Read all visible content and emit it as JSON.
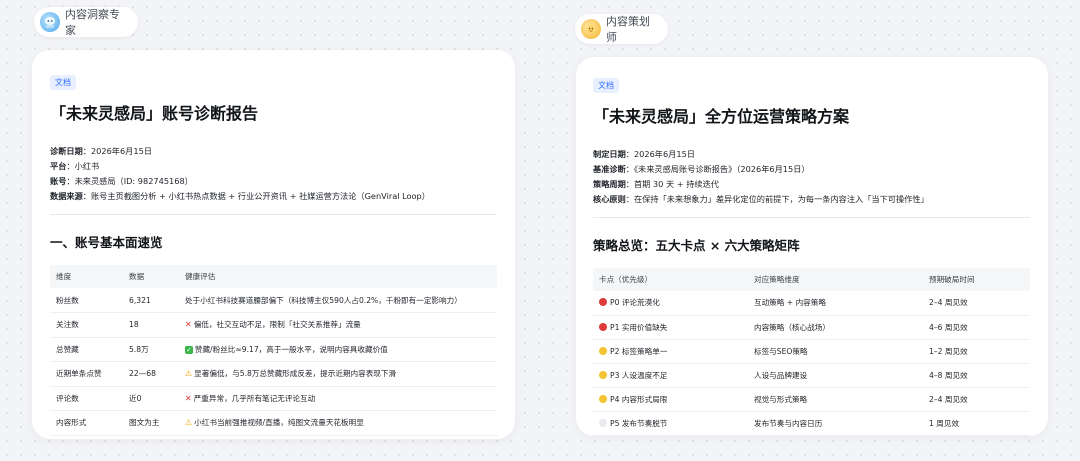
{
  "left_agent": {
    "name": "内容洞察专家",
    "avatar_icon": "jellyfish-avatar-icon"
  },
  "right_agent": {
    "name": "内容策划师",
    "avatar_icon": "sun-avatar-icon"
  },
  "left_doc": {
    "tag": "文档",
    "title": "「未来灵感局」账号诊断报告",
    "meta": [
      {
        "label": "诊断日期",
        "value": "：2026年6月15日"
      },
      {
        "label": "平台",
        "value": "：小红书"
      },
      {
        "label": "账号",
        "value": "：未来灵感局（ID: 982745168）"
      },
      {
        "label": "数据来源",
        "value": "：账号主页截图分析 + 小红书热点数据 + 行业公开资讯 + 社媒运营方法论（GenViral Loop）"
      }
    ],
    "section_title": "一、账号基本面速览",
    "table": {
      "headers": [
        "维度",
        "数据",
        "健康评估"
      ],
      "rows": [
        {
          "dim": "粉丝数",
          "data": "6,321",
          "status": "",
          "eval": "处于小红书科技赛道腰部偏下（科技博主仅590人占0.2%，千粉即有一定影响力）"
        },
        {
          "dim": "关注数",
          "data": "18",
          "status": "x",
          "eval": "偏低，社交互动不足，限制「社交关系推荐」流量"
        },
        {
          "dim": "总赞藏",
          "data": "5.8万",
          "status": "ok",
          "eval": "赞藏/粉丝比≈9.17，高于一般水平，说明内容具收藏价值"
        },
        {
          "dim": "近期单条点赞",
          "data": "22—68",
          "status": "warn",
          "eval": "显著偏低，与5.8万总赞藏形成反差，提示近期内容表现下滑"
        },
        {
          "dim": "评论数",
          "data": "近0",
          "status": "x",
          "eval": "严重异常，几乎所有笔记无评论互动"
        },
        {
          "dim": "内容形式",
          "data": "图文为主",
          "status": "warn",
          "eval": "小红书当前强推视频/直播，纯图文流量天花板明显"
        }
      ]
    }
  },
  "right_doc": {
    "tag": "文档",
    "title": "「未来灵感局」全方位运营策略方案",
    "meta": [
      {
        "label": "制定日期",
        "value": "：2026年6月15日"
      },
      {
        "label": "基准诊断",
        "value": "：《未来灵感局账号诊断报告》（2026年6月15日）"
      },
      {
        "label": "策略周期",
        "value": "：首期 30 天 + 持续迭代"
      },
      {
        "label": "核心原则",
        "value": "：在保持「未来想象力」差异化定位的前提下，为每一条内容注入「当下可操作性」"
      }
    ],
    "section_title": "策略总览：五大卡点 × 六大策略矩阵",
    "table": {
      "headers": [
        "卡点（优先级）",
        "对应策略维度",
        "预期破局时间"
      ],
      "rows": [
        {
          "dot": "#e03a3a",
          "point": "P0 评论荒漠化",
          "strategy": "互动策略 + 内容策略",
          "time": "2–4 周见效"
        },
        {
          "dot": "#e03a3a",
          "point": "P1 实用价值缺失",
          "strategy": "内容策略（核心战场）",
          "time": "4–6 周见效"
        },
        {
          "dot": "#f5c431",
          "point": "P2 标签策略单一",
          "strategy": "标签与SEO策略",
          "time": "1–2 周见效"
        },
        {
          "dot": "#f5c431",
          "point": "P3 人设温度不足",
          "strategy": "人设与品牌建设",
          "time": "4–8 周见效"
        },
        {
          "dot": "#f5c431",
          "point": "P4 内容形式局限",
          "strategy": "视觉与形式策略",
          "time": "2–4 周见效"
        },
        {
          "dot": "#e9e9ee",
          "point": "P5 发布节奏脱节",
          "strategy": "发布节奏与内容日历",
          "time": "1 周见效"
        }
      ]
    }
  }
}
